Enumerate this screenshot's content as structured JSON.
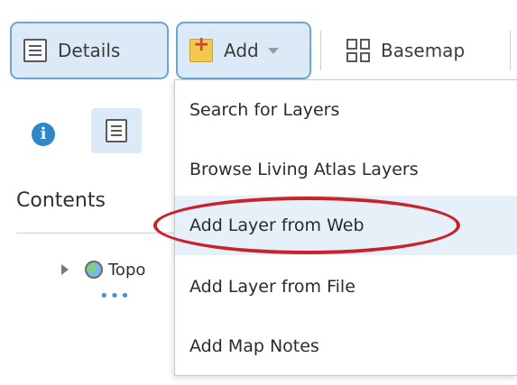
{
  "toolbar": {
    "details_label": "Details",
    "add_label": "Add",
    "basemap_label": "Basemap"
  },
  "contents": {
    "title": "Contents",
    "layer_name": "Topo",
    "more_label": "•••"
  },
  "add_menu": {
    "items": [
      {
        "label": "Search for Layers"
      },
      {
        "label": "Browse Living Atlas Layers"
      },
      {
        "label": "Add Layer from Web"
      },
      {
        "label": "Add Layer from File"
      },
      {
        "label": "Add Map Notes"
      }
    ],
    "highlighted_index": 2
  },
  "colors": {
    "accent_border": "#6aa6d3",
    "button_bg": "#dbeaf6",
    "annotation_circle": "#c8232c",
    "info_icon": "#2f86c8"
  },
  "icons": [
    "details-icon",
    "add-folder-icon",
    "basemap-grid-icon",
    "info-icon",
    "globe-icon",
    "expand-triangle-icon",
    "chevron-down-icon"
  ]
}
